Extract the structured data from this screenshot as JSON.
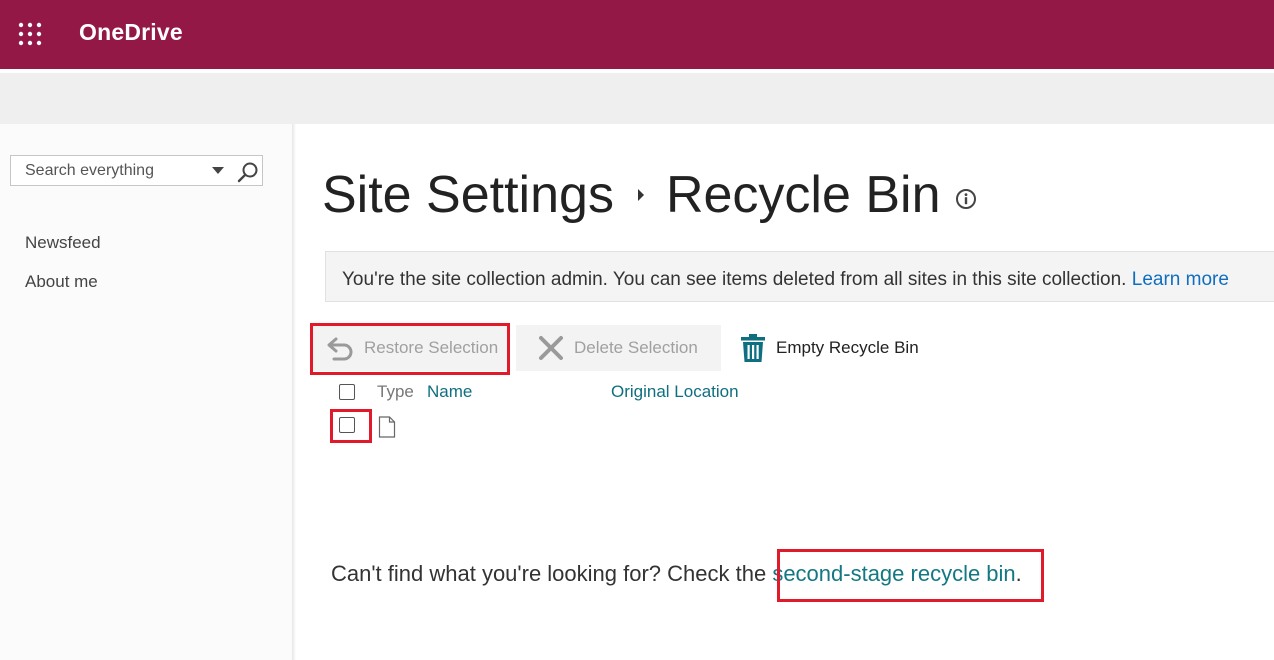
{
  "header": {
    "app_title": "OneDrive",
    "waffle_icon": "app-launcher-icon",
    "bar_color": "#931846"
  },
  "sidebar": {
    "search": {
      "placeholder": "Search everything",
      "value": ""
    },
    "items": [
      {
        "label": "Newsfeed"
      },
      {
        "label": "About me"
      }
    ]
  },
  "main": {
    "breadcrumb": [
      "Site Settings",
      "Recycle Bin"
    ],
    "status": {
      "message": "You're the site collection admin. You can see items deleted from all sites in this site collection.",
      "link": "Learn more"
    },
    "toolbar": {
      "restore_label": "Restore Selection",
      "delete_label": "Delete Selection",
      "empty_label": "Empty Recycle Bin"
    },
    "table": {
      "columns": [
        "Type",
        "Name",
        "Original Location"
      ],
      "rows": [
        {
          "type_icon": "document-icon",
          "name": "",
          "location": ""
        }
      ]
    },
    "help": {
      "prefix": "Can't find what you're looking for? Check the ",
      "link": "second-stage recycle bin",
      "suffix": "."
    }
  },
  "colors": {
    "accent_link": "#137884",
    "highlight": "#e01a2a"
  }
}
